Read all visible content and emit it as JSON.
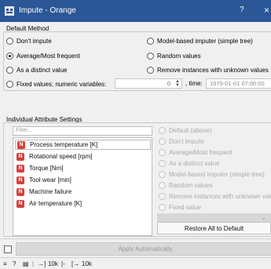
{
  "window": {
    "title": "Impute - Orange",
    "help_glyph": "?",
    "close_glyph": "×"
  },
  "default_method": {
    "group_label": "Default Method",
    "options": [
      {
        "label": "Don't impute",
        "checked": false
      },
      {
        "label": "Model-based imputer (simple tree)",
        "checked": false
      },
      {
        "label": "Average/Most frequent",
        "checked": true
      },
      {
        "label": "Random values",
        "checked": false
      },
      {
        "label": "As a distinct value",
        "checked": false
      },
      {
        "label": "Remove instances with unknown values",
        "checked": false
      },
      {
        "label": "Fixed values; numeric variables:",
        "checked": false
      }
    ],
    "numeric_value": "0",
    "time_label": ", time:",
    "time_value": "1970-01-01 07:00:00"
  },
  "individual": {
    "group_label": "Individual Attribute Settings",
    "filter_placeholder": "Filter...",
    "attributes": [
      {
        "badge": "N",
        "name": "Process temperature [K]",
        "selected": true
      },
      {
        "badge": "N",
        "name": "Rotational speed [rpm]",
        "selected": false
      },
      {
        "badge": "N",
        "name": "Torque [Nm]",
        "selected": false
      },
      {
        "badge": "N",
        "name": "Tool wear [min]",
        "selected": false
      },
      {
        "badge": "N",
        "name": "Machine failure",
        "selected": false
      },
      {
        "badge": "N",
        "name": "Air temperature [K]",
        "selected": false
      }
    ],
    "methods": [
      "Default (above)",
      "Don't impute",
      "Average/Most frequent",
      "As a distinct value",
      "Model-based imputer (simple tree)",
      "Random values",
      "Remove instances with unknown values",
      "Fixed value"
    ],
    "restore_label": "Restore All to Default"
  },
  "bottom": {
    "apply_label": "Apply Automatically",
    "status_in": "10k",
    "status_sep": "|-",
    "status_out": "10k"
  },
  "colors": {
    "titlebar": "#2b5797",
    "numeric_badge": "#d8403c"
  }
}
